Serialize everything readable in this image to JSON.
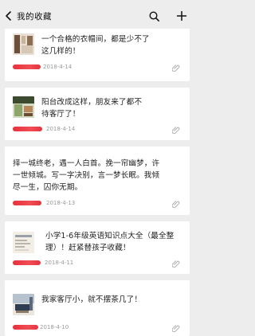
{
  "header": {
    "title": "我的收藏"
  },
  "items": [
    {
      "text_lines": [
        "一个合格的衣帽间，都是少不了",
        "这几样的！"
      ],
      "date": "2018-4-14",
      "thumb_colors": [
        "#6b4f3a",
        "#c9b59a",
        "#e8e0d4"
      ]
    },
    {
      "text_lines": [
        "阳台改成这样，朋友来了都不",
        "待客厅了！"
      ],
      "date": "2018-4-14",
      "thumb_colors": [
        "#3c4a2e",
        "#8fa46a",
        "#d5dcc6"
      ]
    },
    {
      "text_lines": [
        "择一城终老，遇一人白首。挽一帘幽梦，许",
        "一世倾城。写一字决别，言一梦长眠。我倾",
        "尽一生，囚你无期。"
      ],
      "date": "2018-4-13"
    },
    {
      "text_lines": [
        "小学1-6年级英语知识点大全（最全整",
        "理）！赶紧替孩子收藏！"
      ],
      "date": "2018-4-11",
      "thumb_colors": [
        "#9aa0a8",
        "#d9d6cf",
        "#f3efe6"
      ]
    },
    {
      "text_lines": [
        "我家客厅小，就不摆茶几了！"
      ],
      "date": "2018-4-10",
      "thumb_colors": [
        "#2f3d52",
        "#b7c2cf",
        "#eae6df"
      ]
    }
  ]
}
